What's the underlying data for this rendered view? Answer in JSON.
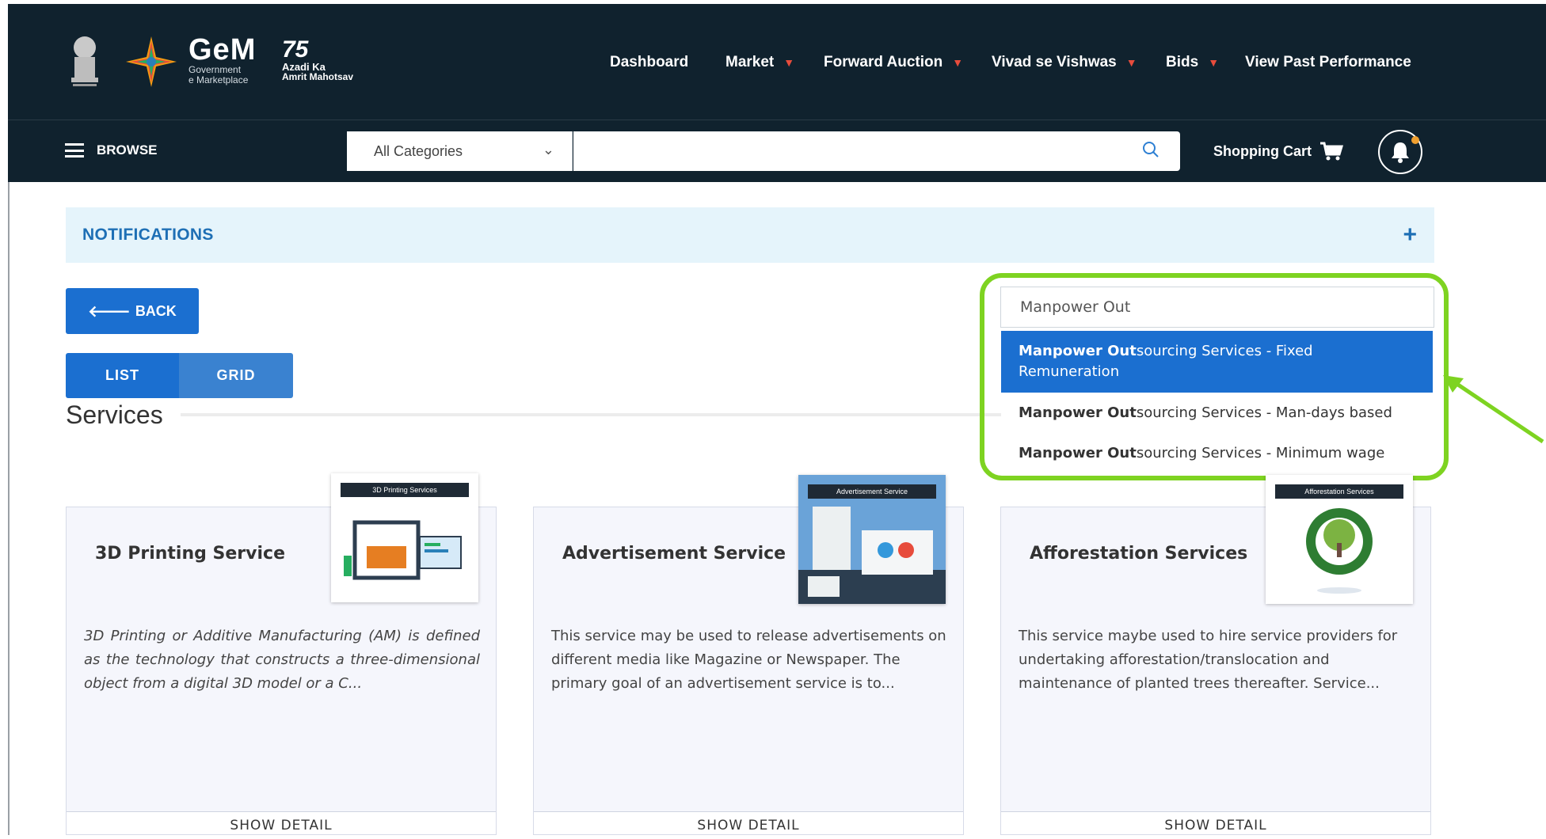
{
  "header": {
    "logo_big": "GeM",
    "logo_sub1": "Government",
    "logo_sub2": "e Marketplace",
    "azadi_num": "75",
    "azadi_line1": "Azadi Ka",
    "azadi_line2": "Amrit Mahotsav",
    "nav": [
      {
        "label": "Dashboard",
        "dropdown": false
      },
      {
        "label": "Market",
        "dropdown": true
      },
      {
        "label": "Forward Auction",
        "dropdown": true
      },
      {
        "label": "Vivad se Vishwas",
        "dropdown": true
      },
      {
        "label": "Bids",
        "dropdown": true
      },
      {
        "label": "View Past Performance",
        "dropdown": false
      }
    ]
  },
  "subbar": {
    "browse": "BROWSE",
    "category_selected": "All Categories",
    "search_value": "",
    "cart_label": "Shopping Cart"
  },
  "notifications": {
    "title": "NOTIFICATIONS",
    "toggle": "+"
  },
  "back_button": "BACK",
  "view_toggle": {
    "list": "LIST",
    "grid": "GRID",
    "active": "list"
  },
  "section_title": "Services",
  "service_search": {
    "value": "Manpower Out",
    "suggestions": [
      {
        "match": "Manpower Out",
        "rest": "sourcing Services - Fixed Remuneration",
        "active": true
      },
      {
        "match": "Manpower Out",
        "rest": "sourcing Services - Man-days based",
        "active": false
      },
      {
        "match": "Manpower Out",
        "rest": "sourcing Services - Minimum wage",
        "active": false
      }
    ]
  },
  "cards": [
    {
      "title": "3D Printing Service",
      "thumb_tag": "3D Printing Services",
      "description": "3D Printing or Additive Manufacturing (AM) is defined as the technology that constructs a three-dimensional object from a digital 3D model or a C...",
      "show_detail": "SHOW DETAIL"
    },
    {
      "title": "Advertisement Service",
      "thumb_tag": "Advertisement Service",
      "description": "This service may be used to release advertisements on different media like Magazine or Newspaper. The primary goal of an advertisement service is to...",
      "show_detail": "SHOW DETAIL"
    },
    {
      "title": "Afforestation Services",
      "thumb_tag": "Afforestation Services",
      "description": "This service maybe used to hire service providers for undertaking afforestation/translocation and maintenance of planted trees thereafter. Service...",
      "show_detail": "SHOW DETAIL"
    }
  ],
  "colors": {
    "header_bg": "#10222e",
    "primary": "#1b6fd0",
    "accent_caret": "#e74c3c",
    "highlight": "#7ed321",
    "notification_bg": "#e5f4fb"
  }
}
